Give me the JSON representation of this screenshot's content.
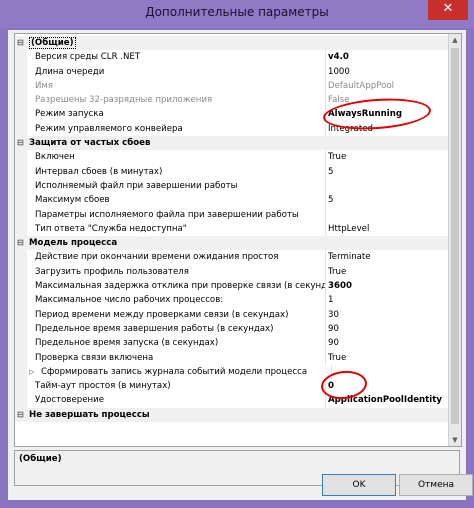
{
  "window": {
    "title": "Дополнительные параметры",
    "close_label": "✕"
  },
  "colors": {
    "titlebar": "#8f7ac6",
    "close": "#c7302a",
    "annotation": "#e00000"
  },
  "grid": {
    "rows": [
      {
        "type": "category",
        "toggle": "⊟",
        "label": "(Общие)",
        "selected": true
      },
      {
        "type": "prop",
        "label": "Версия среды CLR .NET",
        "value": "v4.0",
        "bold": true
      },
      {
        "type": "prop",
        "label": "Длина очереди",
        "value": "1000"
      },
      {
        "type": "prop",
        "label": "Имя",
        "value": "DefaultAppPool",
        "grey": true
      },
      {
        "type": "prop",
        "label": "Разрешены 32-разрядные приложения",
        "value": "False",
        "grey": true
      },
      {
        "type": "prop",
        "label": "Режим запуска",
        "value": "AlwaysRunning",
        "bold": true
      },
      {
        "type": "prop",
        "label": "Режим управляемого конвейера",
        "value": "Integrated"
      },
      {
        "type": "category",
        "toggle": "⊟",
        "label": "Защита от частых сбоев"
      },
      {
        "type": "prop",
        "label": "Включен",
        "value": "True"
      },
      {
        "type": "prop",
        "label": "Интервал сбоев (в минутах)",
        "value": "5"
      },
      {
        "type": "prop",
        "label": "Исполняемый файл при завершении работы",
        "value": ""
      },
      {
        "type": "prop",
        "label": "Максимум сбоев",
        "value": "5"
      },
      {
        "type": "prop",
        "label": "Параметры исполняемого файла при завершении работы",
        "value": ""
      },
      {
        "type": "prop",
        "label": "Тип ответа \"Служба недоступна\"",
        "value": "HttpLevel"
      },
      {
        "type": "category",
        "toggle": "⊟",
        "label": "Модель процесса"
      },
      {
        "type": "prop",
        "label": "Действие при окончании времени ожидания простоя",
        "value": "Terminate"
      },
      {
        "type": "prop",
        "label": "Загрузить профиль пользователя",
        "value": "True"
      },
      {
        "type": "prop",
        "label": "Максимальная задержка отклика при проверке связи (в секундах)",
        "value": "3600",
        "bold": true
      },
      {
        "type": "prop",
        "label": "Максимальное число рабочих процессов:",
        "value": "1"
      },
      {
        "type": "prop",
        "label": "Период времени между проверками связи (в секундах)",
        "value": "30"
      },
      {
        "type": "prop",
        "label": "Предельное время завершения работы (в секундах)",
        "value": "90"
      },
      {
        "type": "prop",
        "label": "Предельное время запуска (в секундах)",
        "value": "90"
      },
      {
        "type": "prop",
        "label": "Проверка связи включена",
        "value": "True"
      },
      {
        "type": "expandable",
        "toggle": "▷",
        "label": "Сформировать запись журнала событий модели процесса",
        "value": ""
      },
      {
        "type": "prop",
        "label": "Тайм-аут простоя (в минутах)",
        "value": "0",
        "bold": true
      },
      {
        "type": "prop",
        "label": "Удостоверение",
        "value": "ApplicationPoolIdentity",
        "bold": true
      },
      {
        "type": "category",
        "toggle": "⊟",
        "label": "Не завершать процессы"
      }
    ]
  },
  "description": {
    "title": "(Общие)"
  },
  "buttons": {
    "ok": "OK",
    "cancel": "Отмена"
  }
}
